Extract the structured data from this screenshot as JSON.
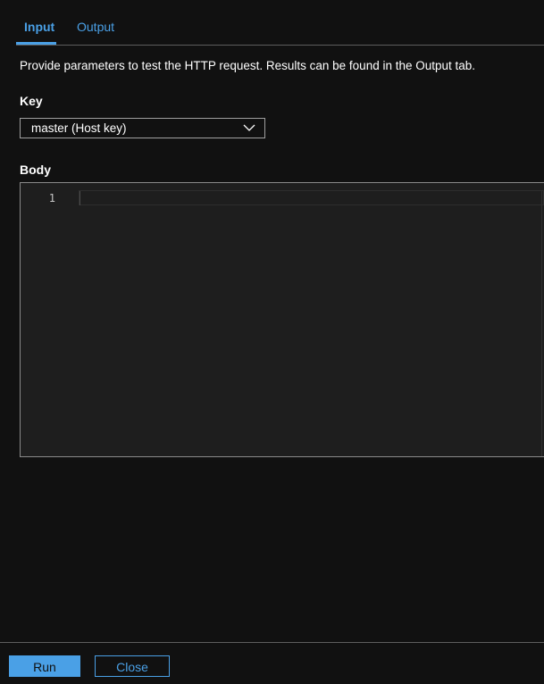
{
  "tabs": [
    {
      "label": "Input",
      "active": true
    },
    {
      "label": "Output",
      "active": false
    }
  ],
  "description": "Provide parameters to test the HTTP request. Results can be found in the Output tab.",
  "key": {
    "label": "Key",
    "selected": "master (Host key)"
  },
  "body": {
    "label": "Body",
    "line_numbers": [
      "1"
    ],
    "content": ""
  },
  "footer": {
    "run_label": "Run",
    "close_label": "Close"
  },
  "colors": {
    "accent": "#4aa0e6",
    "background": "#111111",
    "editor_background": "#1e1e1e"
  },
  "icons": {
    "dropdown": "chevron-down-icon"
  }
}
